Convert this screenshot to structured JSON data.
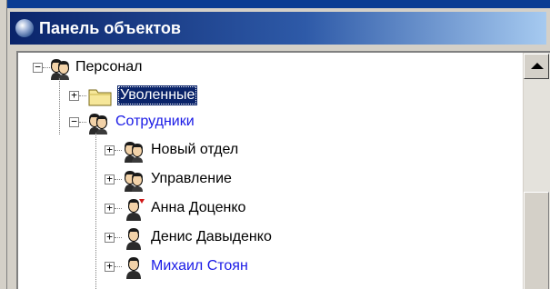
{
  "window": {
    "title": "Панель объектов"
  },
  "tree": {
    "root": {
      "label": "Персонал"
    },
    "children": [
      {
        "label": "Уволенные"
      },
      {
        "label": "Сотрудники"
      }
    ],
    "employees": [
      {
        "label": "Новый отдел"
      },
      {
        "label": "Управление"
      },
      {
        "label": "Анна Доценко"
      },
      {
        "label": "Денис Давыденко"
      },
      {
        "label": "Михаил Стоян"
      }
    ]
  },
  "colors": {
    "title_bg_start": "#0a246a",
    "title_bg_end": "#a6caf0",
    "selection": "#0a246a",
    "link_text": "#1a1ae6"
  },
  "icons": [
    "group-icon",
    "folder-icon",
    "person-icon"
  ]
}
